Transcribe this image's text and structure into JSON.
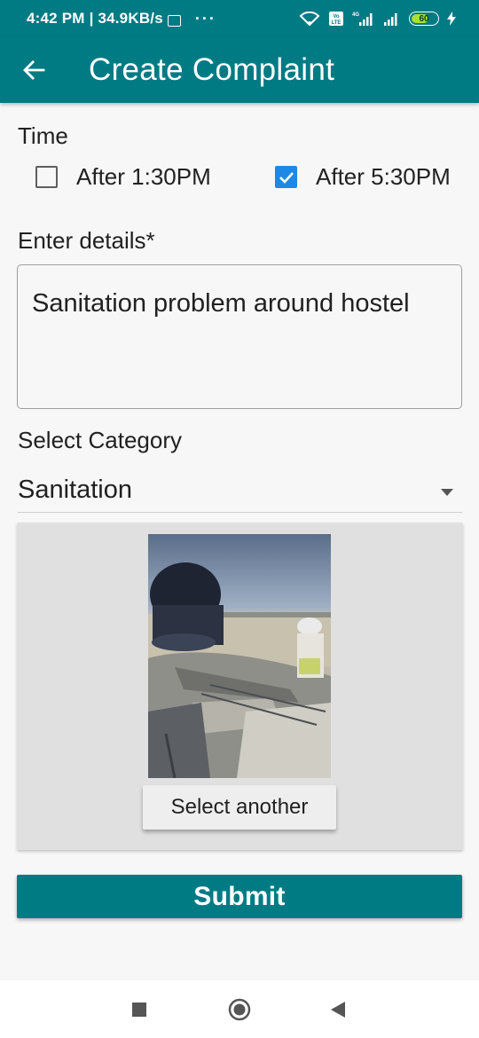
{
  "status_bar": {
    "time_speed": "4:42 PM | 34.9KB/s",
    "dots": "···",
    "network": "4G",
    "volte": "Vo LTE",
    "battery": "60"
  },
  "app_bar": {
    "title": "Create Complaint",
    "back_icon": "arrow-left-icon"
  },
  "form": {
    "time_label": "Time",
    "time_options": [
      {
        "label": "After 1:30PM",
        "checked": false
      },
      {
        "label": "After 5:30PM",
        "checked": true
      }
    ],
    "details_label": "Enter details*",
    "details_value": "Sanitation problem around hostel",
    "category_label": "Select Category",
    "category_value": "Sanitation",
    "select_another_label": "Select another",
    "submit_label": "Submit"
  },
  "colors": {
    "primary": "#007b84",
    "checkbox_checked": "#1e88e5",
    "card_bg": "#e0e0e0"
  },
  "nav_bar": {
    "icons": [
      "square-recents-icon",
      "circle-home-icon",
      "triangle-back-icon"
    ]
  }
}
